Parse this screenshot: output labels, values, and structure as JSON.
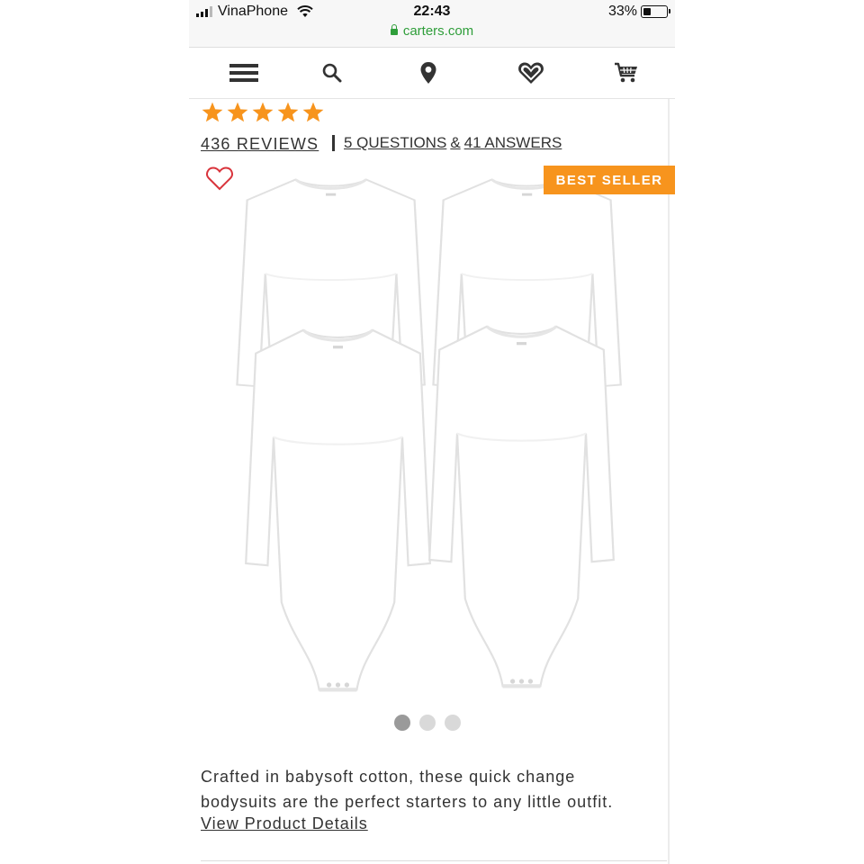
{
  "status_bar": {
    "carrier": "VinaPhone",
    "time": "22:43",
    "battery_percent": "33%",
    "battery_level": 0.33,
    "url": "carters.com"
  },
  "nav": {
    "items": [
      "menu-icon",
      "search-icon",
      "location-icon",
      "heart-icon",
      "cart-icon"
    ]
  },
  "product": {
    "rating_stars": 5,
    "reviews_link": "436 REVIEWS",
    "qa_link": {
      "questions": "5 QUESTIONS",
      "amp": "&",
      "answers": "41 ANSWERS"
    },
    "badge": "BEST SELLER",
    "image_carousel": {
      "count": 3,
      "active_index": 0
    },
    "description": "Crafted in babysoft cotton, these quick change bodysuits are the perfect starters to any little outfit.",
    "details_link": "View Product Details"
  },
  "colors": {
    "accent_orange": "#f7941d",
    "url_green": "#2f9e3a",
    "text": "#333333"
  }
}
